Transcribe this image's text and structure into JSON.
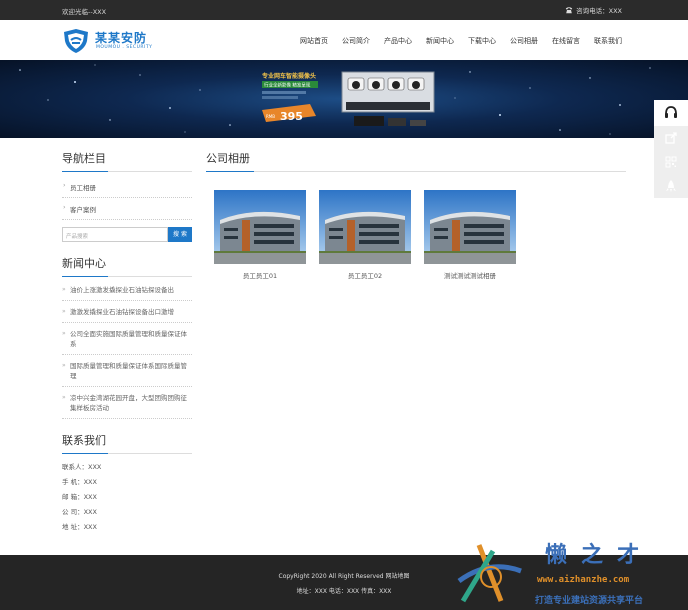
{
  "topbar": {
    "welcome": "欢迎光临--XXX",
    "phone_label": "咨询电话：XXX"
  },
  "logo": {
    "name_cn": "某某安防",
    "name_en": "MOUMOU . SECURITY"
  },
  "nav": [
    "网站首页",
    "公司简介",
    "产品中心",
    "新闻中心",
    "下载中心",
    "公司相册",
    "在线留言",
    "联系我们"
  ],
  "banner": {
    "ad_lines": [
      "专业网车智能摄像头",
      "行业全新影像 精准呈现"
    ],
    "price_prefix": "RMB",
    "price": "395"
  },
  "sidebar": {
    "nav_title": "导航栏目",
    "categories": [
      "员工相册",
      "客户案例"
    ],
    "search": {
      "placeholder": "产品搜索",
      "button": "搜 索"
    },
    "news_title": "新闻中心",
    "news": [
      "油价上涨激发撬探业石油钻探设备出",
      "激激发撬探业石油钻探设备出口激增",
      "公司全面实施国际质量管理和质量保证体系",
      "国际质量管理和质量保证体系国际质量管理",
      "凉中兴金湾湖花园开盘，大型团购团购征集样板房活动"
    ],
    "contact_title": "联系我们",
    "contact": [
      "联系人：XXX",
      "手 机：XXX",
      "邮 箱：XXX",
      "公 司：XXX",
      "地 址：XXX"
    ]
  },
  "main": {
    "title": "公司相册",
    "photos": [
      {
        "caption": "员工员工01"
      },
      {
        "caption": "员工员工02"
      },
      {
        "caption": "测试测试测试相册"
      }
    ]
  },
  "footer": {
    "copyright": "CopyRight 2020 All Right Reserved   网站地图",
    "contact": "地址：XXX  电话：XXX  传真：XXX"
  },
  "watermark": {
    "title": "懒之才",
    "url": "www.aizhanzhe.com",
    "slogan": "打造专业建站资源共享平台"
  },
  "colors": {
    "accent": "#1e78c8",
    "topbar": "#2b2b2b",
    "footer": "#252525"
  },
  "icons": [
    "phone-icon",
    "headset-icon",
    "share-icon",
    "qrcode-icon",
    "rocket-icon"
  ]
}
